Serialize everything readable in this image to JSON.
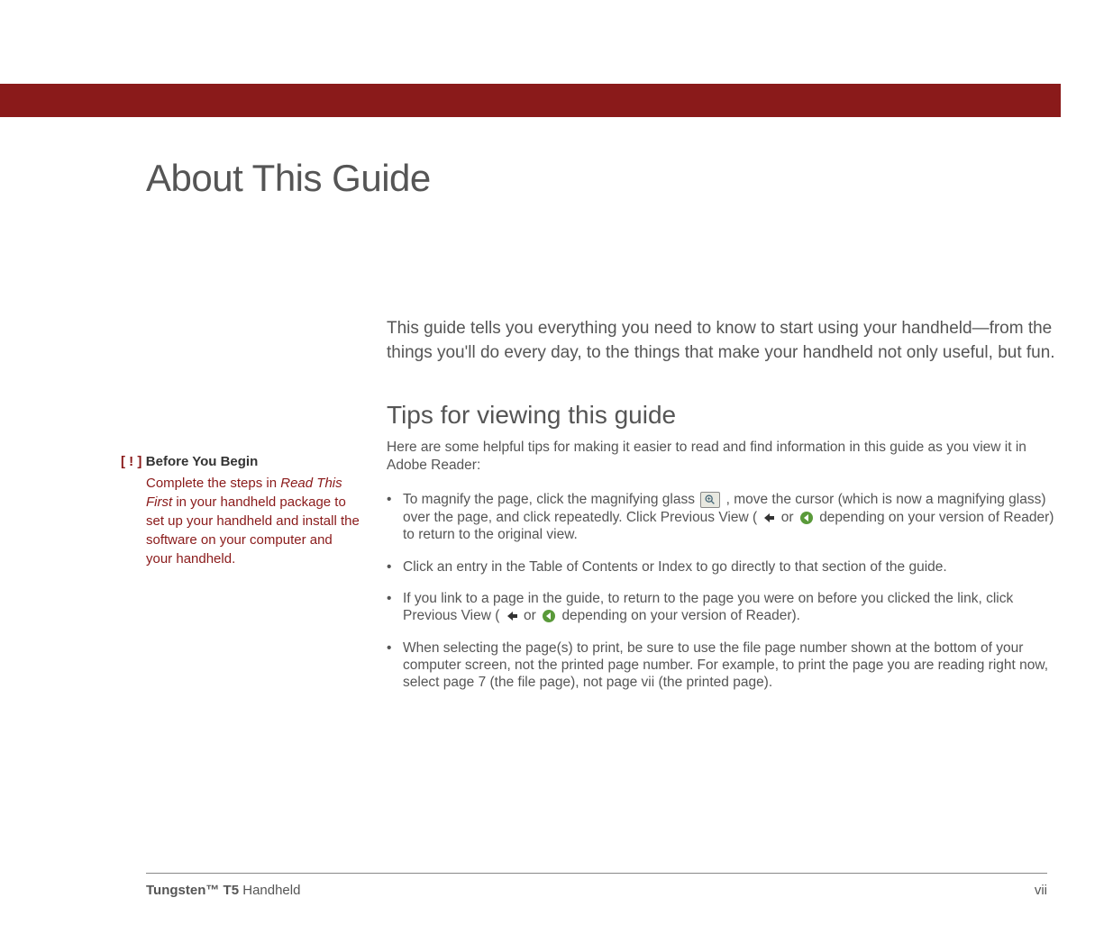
{
  "pageTitle": "About This Guide",
  "sidebar": {
    "marker": "[ ! ]",
    "title": "Before You Begin",
    "body_pre": "Complete the steps in ",
    "body_italic": "Read This First",
    "body_post": " in your handheld package to set up your handheld and install the software on your computer and your handheld."
  },
  "intro": "This guide tells you everything you need to know to start using your handheld—from the things you'll do every day, to the things that make your handheld not only useful, but fun.",
  "section": {
    "heading": "Tips for viewing this guide",
    "intro": "Here are some helpful tips for making it easier to read and find information in this guide as you view it in Adobe Reader:"
  },
  "tips": {
    "t1a": "To magnify the page, click the magnifying glass ",
    "t1b": ", move the cursor (which is now a magnifying glass) over the page, and click repeatedly. Click Previous View (",
    "t1c": " or ",
    "t1d": " depending on your version of Reader) to return to the original view.",
    "t2": "Click an entry in the Table of Contents or Index to go directly to that section of the guide.",
    "t3a": "If you link to a page in the guide, to return to the page you were on before you clicked the link, click Previous View (",
    "t3b": " or ",
    "t3c": " depending on your version of Reader).",
    "t4": "When selecting the page(s) to print, be sure to use the file page number shown at the bottom of your computer screen, not the printed page number. For example, to print the page you are reading right now, select page 7 (the file page), not page vii (the printed page)."
  },
  "footer": {
    "product_bold": "Tungsten™ T5",
    "product_rest": " Handheld",
    "pageNum": "vii"
  }
}
